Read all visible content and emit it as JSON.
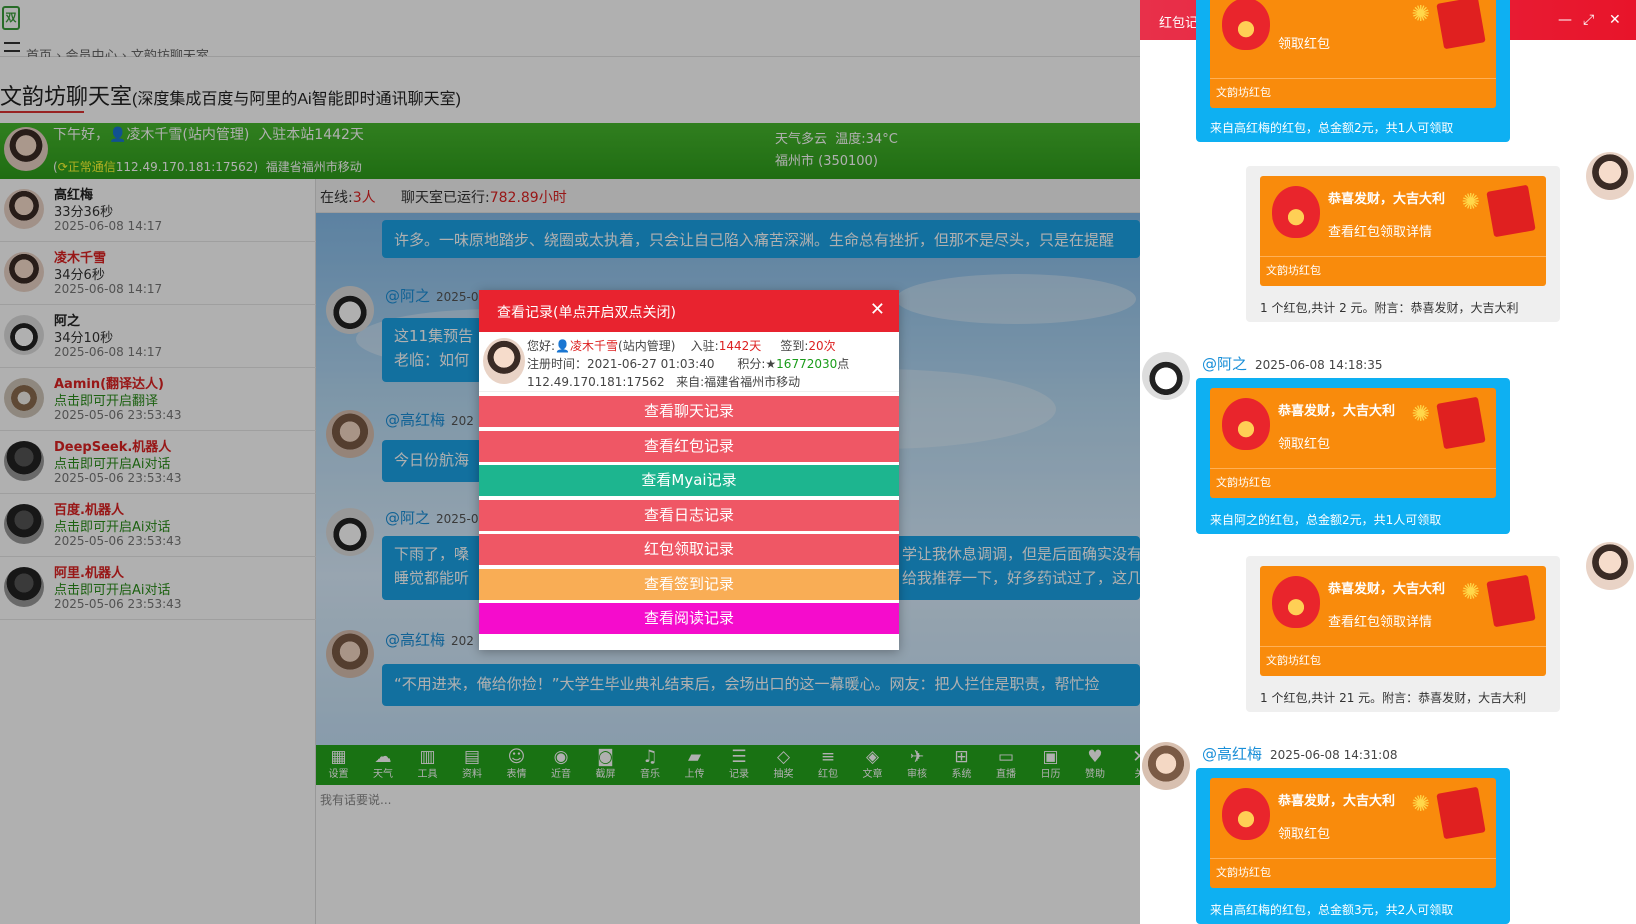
{
  "header": {
    "breadcrumb": "首页 › 会员中心 › 文韵坊聊天室",
    "room_title": "文韵坊聊天室",
    "room_subtitle": "(深度集成百度与阿里的Ai智能即时通讯聊天室)"
  },
  "welcome": {
    "greeting": "下午好，",
    "user": "凌木千雪(站内管理)",
    "joined": "入驻本站1442天",
    "status_label": "正常通信",
    "ip": "112.49.170.181:17562)",
    "location": "福建省福州市移动",
    "weather": "天气多云",
    "temperature": "温度:34°C",
    "city": "福州市 (350100)"
  },
  "users": [
    {
      "name": "高红梅",
      "sub": "33分36秒",
      "time": "2025-06-08 14:17",
      "name_color": "dark",
      "avatar": "woman-avatar"
    },
    {
      "name": "凌木千雪",
      "sub": "34分6秒",
      "time": "2025-06-08 14:17",
      "name_color": "red",
      "avatar": "woman-avatar"
    },
    {
      "name": "阿之",
      "sub": "34分10秒",
      "time": "2025-06-08 14:17",
      "name_color": "dark",
      "avatar": "cartoon-avatar"
    },
    {
      "name": "Aamin(翻译达人)",
      "sub": "点击即可开启翻译",
      "time": "2025-05-06 23:53:43",
      "name_color": "red",
      "avatar": "dog-avatar"
    },
    {
      "name": "DeepSeek.机器人",
      "sub": "点击即可开启Ai对话",
      "time": "2025-05-06 23:53:43",
      "name_color": "red",
      "avatar": "bot-avatar"
    },
    {
      "name": "百度.机器人",
      "sub": "点击即可开启Ai对话",
      "time": "2025-05-06 23:53:43",
      "name_color": "red",
      "avatar": "bot-avatar"
    },
    {
      "name": "阿里.机器人",
      "sub": "点击即可开启Ai对话",
      "time": "2025-05-06 23:53:43",
      "name_color": "red",
      "avatar": "bot-avatar"
    }
  ],
  "status": {
    "online_label": "在线:",
    "online_count": "3人",
    "runtime_label": "聊天室已运行:",
    "runtime_value": "782.89小时"
  },
  "messages": [
    {
      "name": "",
      "time": "",
      "text": "许多。一味原地踏步、绕圈或太执着，只会让自己陷入痛苦深渊。生命总有挫折，但那不是尽头，只是在提醒"
    },
    {
      "name": "@阿之",
      "time": "2025-0",
      "text": "这11集预告",
      "text2": "老临：如何"
    },
    {
      "name": "@高红梅",
      "time": "202",
      "text": "今日份航海"
    },
    {
      "name": "@阿之",
      "time": "2025-0",
      "text": "下雨了，嗓",
      "text2": "睡觉都能听",
      "text3": "学让我休息调调，但是后面确实没有",
      "text4": "给我推荐一下，好多药试过了，这几"
    },
    {
      "name": "@高红梅",
      "time": "202",
      "text": "“不用进来，俺给你捡！”大学生毕业典礼结束后，会场出口的这一幕暖心。网友：把人拦住是职责，帮忙捡"
    }
  ],
  "toolbar": [
    {
      "label": "设置",
      "glyph": "▦",
      "icon": "grid-icon"
    },
    {
      "label": "天气",
      "glyph": "☁",
      "icon": "cloud-icon"
    },
    {
      "label": "工具",
      "glyph": "▥",
      "icon": "bank-icon"
    },
    {
      "label": "资料",
      "glyph": "▤",
      "icon": "id-card-icon"
    },
    {
      "label": "表情",
      "glyph": "☺",
      "icon": "smile-icon"
    },
    {
      "label": "近音",
      "glyph": "◉",
      "icon": "user-circle-icon"
    },
    {
      "label": "截屏",
      "glyph": "◙",
      "icon": "camera-icon"
    },
    {
      "label": "音乐",
      "glyph": "♫",
      "icon": "music-icon"
    },
    {
      "label": "上传",
      "glyph": "▰",
      "icon": "folder-icon"
    },
    {
      "label": "记录",
      "glyph": "☰",
      "icon": "list-icon"
    },
    {
      "label": "抽奖",
      "glyph": "◇",
      "icon": "diamond-icon"
    },
    {
      "label": "红包",
      "glyph": "≡",
      "icon": "database-icon"
    },
    {
      "label": "文章",
      "glyph": "◈",
      "icon": "rss-icon"
    },
    {
      "label": "审核",
      "glyph": "✈",
      "icon": "bird-icon"
    },
    {
      "label": "系统",
      "glyph": "⊞",
      "icon": "windows-icon"
    },
    {
      "label": "直播",
      "glyph": "▭",
      "icon": "monitor-icon"
    },
    {
      "label": "日历",
      "glyph": "▣",
      "icon": "calendar-icon"
    },
    {
      "label": "赞助",
      "glyph": "♥",
      "icon": "heart-icon"
    },
    {
      "label": "关",
      "glyph": "✕",
      "icon": "close-icon"
    }
  ],
  "input": {
    "placeholder": "我有话要说..."
  },
  "modal": {
    "title": "查看记录(单点开启双点关闭)",
    "info": {
      "hello": "您好:",
      "user": "凌木千雪",
      "role": "(站内管理)",
      "join_label": "入驻:",
      "join_value": "1442天",
      "sign_label": "签到:",
      "sign_value": "20次",
      "reg_label": "注册时间：",
      "reg_value": "2021-06-27 01:03:40",
      "points_label": "积分:",
      "points_value": "16772030",
      "points_unit": "点",
      "ip": "112.49.170.181:17562",
      "from_label": "来自:",
      "from_value": "福建省福州市移动"
    },
    "buttons": [
      {
        "label": "查看聊天记录",
        "color": "#ef5765"
      },
      {
        "label": "查看红包记录",
        "color": "#ef5765"
      },
      {
        "label": "查看Myai记录",
        "color": "#1db58f"
      },
      {
        "label": "查看日志记录",
        "color": "#ef5765"
      },
      {
        "label": "红包领取记录",
        "color": "#ef5765"
      },
      {
        "label": "查看签到记录",
        "color": "#f9ad55"
      },
      {
        "label": "查看阅读记录",
        "color": "#f50ccc"
      }
    ]
  },
  "panel": {
    "title": "红包记录",
    "entries": [
      {
        "side": "left",
        "name": "",
        "time": "",
        "bless": "",
        "action": "领取红包",
        "brand": "文韵坊红包",
        "footer": "来自高红梅的红包，总金额2元，共1人可领取"
      },
      {
        "side": "right",
        "name": "",
        "time": "",
        "bless": "恭喜发财，大吉大利",
        "action": "查看红包领取详情",
        "brand": "文韵坊红包",
        "footer": "1 个红包,共计 2 元。附言：恭喜发财，大吉大利"
      },
      {
        "side": "left",
        "name": "@阿之",
        "time": "2025-06-08 14:18:35",
        "bless": "恭喜发财，大吉大利",
        "action": "领取红包",
        "brand": "文韵坊红包",
        "footer": "来自阿之的红包，总金额2元，共1人可领取"
      },
      {
        "side": "right",
        "name": "",
        "time": "",
        "bless": "恭喜发财，大吉大利",
        "action": "查看红包领取详情",
        "brand": "文韵坊红包",
        "footer": "1 个红包,共计 21 元。附言：恭喜发财，大吉大利"
      },
      {
        "side": "left",
        "name": "@高红梅",
        "time": "2025-06-08 14:31:08",
        "bless": "恭喜发财，大吉大利",
        "action": "领取红包",
        "brand": "文韵坊红包",
        "footer": "来自高红梅的红包，总金额3元，共2人可领取"
      }
    ]
  },
  "colors": {
    "brand_green": "#2e9e1b",
    "accent_red": "#e8232f",
    "bubble_blue": "#1ba3e6",
    "packet_orange": "#f98b0c"
  }
}
